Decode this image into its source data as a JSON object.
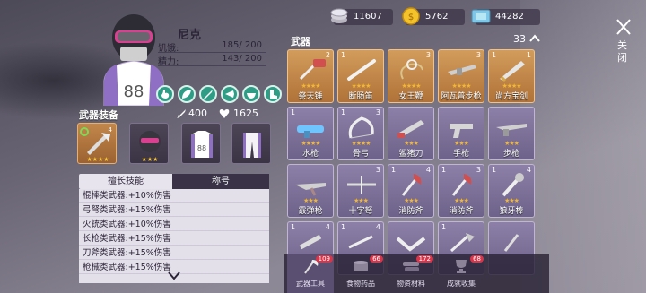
{
  "currency": [
    {
      "icon": "gear-coin-icon",
      "value": "11607"
    },
    {
      "icon": "gold-coin-icon",
      "value": "5762"
    },
    {
      "icon": "ticket-icon",
      "value": "44282"
    }
  ],
  "character": {
    "name": "尼克",
    "stats": [
      {
        "label": "饥饿:",
        "value": "185/ 200"
      },
      {
        "label": "精力:",
        "value": "143/ 200"
      }
    ]
  },
  "equipment": {
    "title": "武器装备",
    "power": "400",
    "hp": "1625"
  },
  "skill_tabs": [
    "擅长技能",
    "称号"
  ],
  "skills": [
    "棍棒类武器:+10%伤害",
    "弓弩类武器:+15%伤害",
    "火铳类武器:+10%伤害",
    "长枪类武器:+15%伤害",
    "刀斧类武器:+15%伤害",
    "枪械类武器:+15%伤害"
  ],
  "weapons": {
    "title": "武器",
    "count": "33",
    "items": [
      {
        "name": "祭天锤",
        "lv": "",
        "cnt": "2",
        "stars": "★★★★",
        "style": "orange"
      },
      {
        "name": "断肠笛",
        "lv": "1",
        "cnt": "",
        "stars": "★★★★",
        "style": "orange"
      },
      {
        "name": "女王鞭",
        "lv": "",
        "cnt": "3",
        "stars": "★★★★",
        "style": "orange"
      },
      {
        "name": "阿瓦普步枪",
        "lv": "",
        "cnt": "3",
        "stars": "★★★★",
        "style": "orange"
      },
      {
        "name": "尚方宝剑",
        "lv": "1",
        "cnt": "1",
        "stars": "★★★★",
        "style": "orange"
      },
      {
        "name": "水枪",
        "lv": "1",
        "cnt": "",
        "stars": "★★★★",
        "style": "lav"
      },
      {
        "name": "骨弓",
        "lv": "1",
        "cnt": "3",
        "stars": "★★★★",
        "style": "lav"
      },
      {
        "name": "鲨猪刀",
        "lv": "",
        "cnt": "",
        "stars": "★★★",
        "style": "lav"
      },
      {
        "name": "手枪",
        "lv": "",
        "cnt": "",
        "stars": "★★★",
        "style": "lav"
      },
      {
        "name": "步枪",
        "lv": "",
        "cnt": "",
        "stars": "★★★",
        "style": "lav"
      },
      {
        "name": "霰弹枪",
        "lv": "",
        "cnt": "",
        "stars": "★★★",
        "style": "lav"
      },
      {
        "name": "十字弩",
        "lv": "",
        "cnt": "3",
        "stars": "★★★",
        "style": "lav"
      },
      {
        "name": "消防斧",
        "lv": "1",
        "cnt": "4",
        "stars": "★★★",
        "style": "lav"
      },
      {
        "name": "消防斧",
        "lv": "1",
        "cnt": "3",
        "stars": "★★★",
        "style": "lav"
      },
      {
        "name": "狼牙棒",
        "lv": "1",
        "cnt": "4",
        "stars": "★★★",
        "style": "lav"
      },
      {
        "name": "",
        "lv": "1",
        "cnt": "4",
        "stars": "",
        "style": "lav"
      },
      {
        "name": "",
        "lv": "1",
        "cnt": "4",
        "stars": "",
        "style": "lav"
      },
      {
        "name": "",
        "lv": "",
        "cnt": "",
        "stars": "",
        "style": "lav"
      },
      {
        "name": "",
        "lv": "1",
        "cnt": "",
        "stars": "",
        "style": "lav"
      },
      {
        "name": "",
        "lv": "",
        "cnt": "",
        "stars": "",
        "style": "lav"
      }
    ]
  },
  "bottom_tabs": [
    {
      "label": "武器工具",
      "badge": "109"
    },
    {
      "label": "食物药品",
      "badge": "66"
    },
    {
      "label": "物资材料",
      "badge": "172"
    },
    {
      "label": "成就收集",
      "badge": "68"
    }
  ],
  "close_label": "关闭"
}
